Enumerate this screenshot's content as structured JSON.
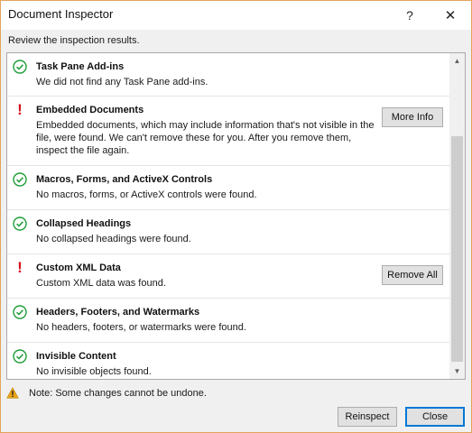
{
  "window": {
    "title": "Document Inspector",
    "help": "?",
    "close": "✕"
  },
  "subtitle": "Review the inspection results.",
  "results": [
    {
      "status": "ok",
      "title": "Task Pane Add-ins",
      "desc": "We did not find any Task Pane add-ins.",
      "action": ""
    },
    {
      "status": "warn",
      "title": "Embedded Documents",
      "desc": "Embedded documents, which may include information that's not visible in the file, were found. We can't remove these for you. After you remove them, inspect the file again.",
      "action": "More Info"
    },
    {
      "status": "ok",
      "title": "Macros, Forms, and ActiveX Controls",
      "desc": "No macros, forms, or ActiveX controls were found.",
      "action": ""
    },
    {
      "status": "ok",
      "title": "Collapsed Headings",
      "desc": "No collapsed headings were found.",
      "action": ""
    },
    {
      "status": "warn",
      "title": "Custom XML Data",
      "desc": "Custom XML data was found.",
      "action": "Remove All"
    },
    {
      "status": "ok",
      "title": "Headers, Footers, and Watermarks",
      "desc": "No headers, footers, or watermarks were found.",
      "action": ""
    },
    {
      "status": "ok",
      "title": "Invisible Content",
      "desc": "No invisible objects found.",
      "action": ""
    }
  ],
  "note": "Note: Some changes cannot be undone.",
  "buttons": {
    "reinspect": "Reinspect",
    "close": "Close"
  },
  "colors": {
    "ok": "#1e9e3a",
    "warn": "#d8101c",
    "note_icon": "#e8a317",
    "accent": "#0078d7"
  },
  "icons": {
    "ok": "check-circle-icon",
    "warn": "exclamation-icon",
    "note": "warning-triangle-icon"
  }
}
